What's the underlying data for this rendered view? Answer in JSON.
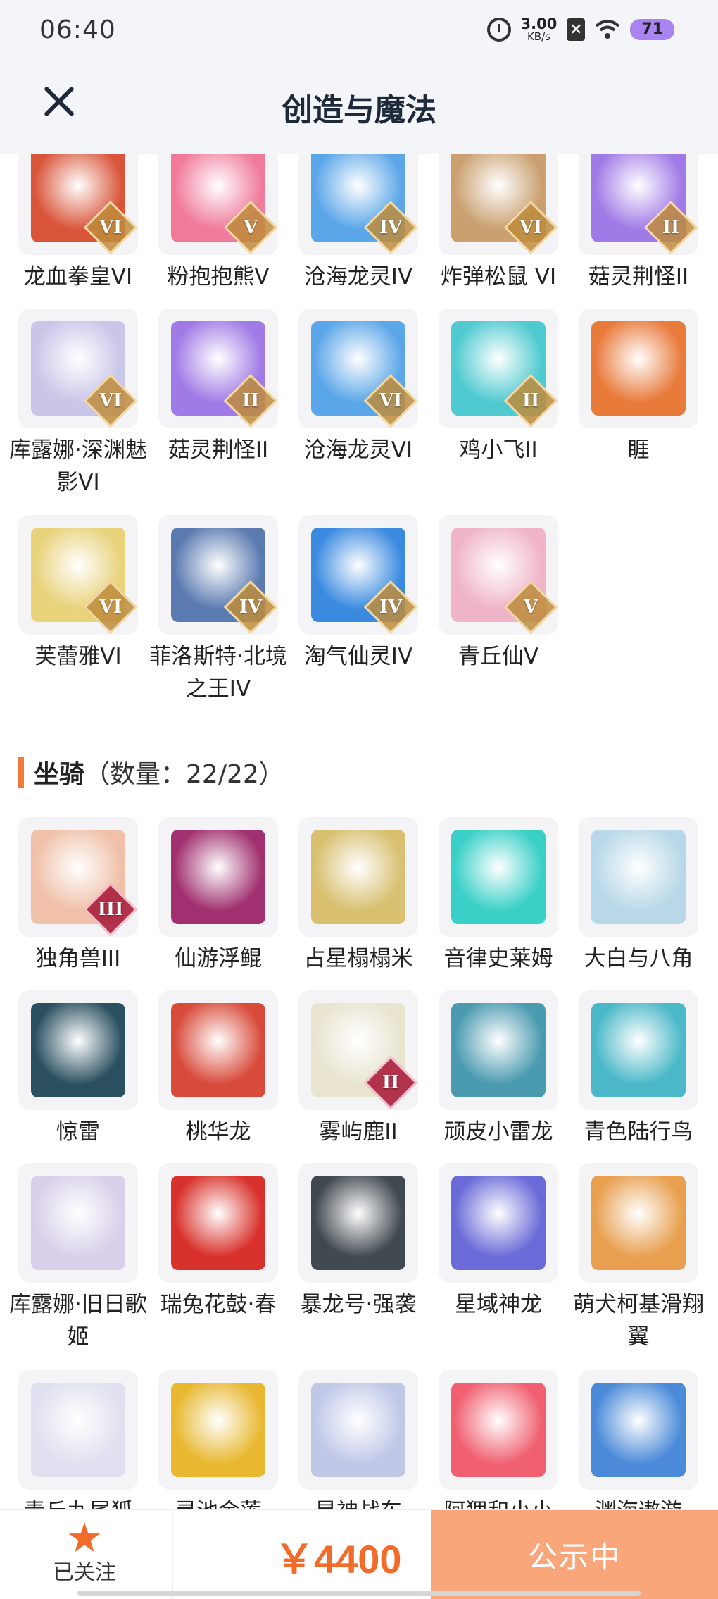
{
  "status": {
    "time": "06:40",
    "net_speed": "3.00",
    "net_unit": "KB/s",
    "battery": "71"
  },
  "header": {
    "title": "创造与魔法"
  },
  "pets": [
    {
      "label": "龙血拳皇VI",
      "badge": "VI",
      "icon": "red-dragon-icon",
      "color": "#d9553a"
    },
    {
      "label": "粉抱抱熊Ⅴ",
      "badge": "V",
      "icon": "pink-bear-icon",
      "color": "#f07a9a"
    },
    {
      "label": "沧海龙灵IV",
      "badge": "IV",
      "icon": "blue-dragon-girl-icon",
      "color": "#5aa6e8"
    },
    {
      "label": "炸弹松鼠 VI",
      "badge": "VI",
      "icon": "squirrel-icon",
      "color": "#caa070"
    },
    {
      "label": "菇灵荆怪II",
      "badge": "II",
      "icon": "purple-mushroom-icon",
      "color": "#a07ae6"
    },
    {
      "label": "库露娜·深渊魅影VI",
      "badge": "VI",
      "icon": "white-hair-girl-icon",
      "color": "#c9c6e8"
    },
    {
      "label": "菇灵荆怪II",
      "badge": "II",
      "icon": "purple-mushroom-icon",
      "color": "#a07ae6"
    },
    {
      "label": "沧海龙灵VI",
      "badge": "VI",
      "icon": "blue-dragon-girl-icon",
      "color": "#5aa6e8"
    },
    {
      "label": "鸡小飞II",
      "badge": "II",
      "icon": "chick-icon",
      "color": "#4fcad0"
    },
    {
      "label": "睚",
      "badge": "",
      "icon": "fire-dragon-icon",
      "color": "#e87a3a"
    },
    {
      "label": "芙蕾雅VI",
      "badge": "VI",
      "icon": "valkyrie-icon",
      "color": "#e8d27a"
    },
    {
      "label": "菲洛斯特·北境之王IV",
      "badge": "IV",
      "icon": "ice-dragon-icon",
      "color": "#5a7ab0"
    },
    {
      "label": "淘气仙灵IV",
      "badge": "IV",
      "icon": "blue-dog-icon",
      "color": "#3a8ae0"
    },
    {
      "label": "青丘仙V",
      "badge": "V",
      "icon": "fox-girl-icon",
      "color": "#f0b4c8"
    }
  ],
  "mounts_section": {
    "title": "坐骑",
    "count": "（数量：22/22）"
  },
  "mounts": [
    {
      "label": "独角兽III",
      "badge": "III",
      "icon": "unicorn-icon",
      "color": "#f0c0a8"
    },
    {
      "label": "仙游浮鲲",
      "badge": "",
      "icon": "fish-mount-icon",
      "color": "#a03070"
    },
    {
      "label": "占星榻榻米",
      "badge": "",
      "icon": "crystal-icon",
      "color": "#d8c070"
    },
    {
      "label": "音律史莱姆",
      "badge": "",
      "icon": "slime-icon",
      "color": "#3ad0c8"
    },
    {
      "label": "大白与八角",
      "badge": "",
      "icon": "whale-icon",
      "color": "#b8d8e8"
    },
    {
      "label": "惊雷",
      "badge": "",
      "icon": "thunder-beast-icon",
      "color": "#2a5060"
    },
    {
      "label": "桃华龙",
      "badge": "",
      "icon": "peach-dragon-icon",
      "color": "#d84a3a"
    },
    {
      "label": "雾屿鹿II",
      "badge": "II",
      "icon": "deer-icon",
      "color": "#e8e4d0"
    },
    {
      "label": "顽皮小雷龙",
      "badge": "",
      "icon": "dino-icon",
      "color": "#4a9ab0"
    },
    {
      "label": "青色陆行鸟",
      "badge": "",
      "icon": "bird-icon",
      "color": "#4ab8c8"
    },
    {
      "label": "库露娜·旧日歌姬",
      "badge": "",
      "icon": "white-hair-girl-icon",
      "color": "#d8d0ea"
    },
    {
      "label": "瑞兔花鼓·春",
      "badge": "",
      "icon": "drum-icon",
      "color": "#d8302a"
    },
    {
      "label": "暴龙号·强袭",
      "badge": "",
      "icon": "mecha-dino-icon",
      "color": "#404850"
    },
    {
      "label": "星域神龙",
      "badge": "",
      "icon": "star-dragon-icon",
      "color": "#6a6ad8"
    },
    {
      "label": "萌犬柯基滑翔翼",
      "badge": "",
      "icon": "corgi-icon",
      "color": "#e8a050"
    },
    {
      "label": "青丘九尾狐",
      "badge": "",
      "icon": "nine-tail-fox-icon",
      "color": "#e0e0f0"
    },
    {
      "label": "灵池金莲",
      "badge": "",
      "icon": "golden-lotus-icon",
      "color": "#e8b830"
    },
    {
      "label": "星神战车",
      "badge": "",
      "icon": "star-chariot-icon",
      "color": "#c0c8e8"
    },
    {
      "label": "阿狸和小小",
      "badge": "",
      "icon": "ali-fox-icon",
      "color": "#f06070"
    },
    {
      "label": "渊海遨游",
      "badge": "",
      "icon": "sea-dragon-icon",
      "color": "#4a8ad8"
    }
  ],
  "bottom": {
    "follow_label": "已关注",
    "price": "￥4400",
    "action_label": "公示中"
  }
}
